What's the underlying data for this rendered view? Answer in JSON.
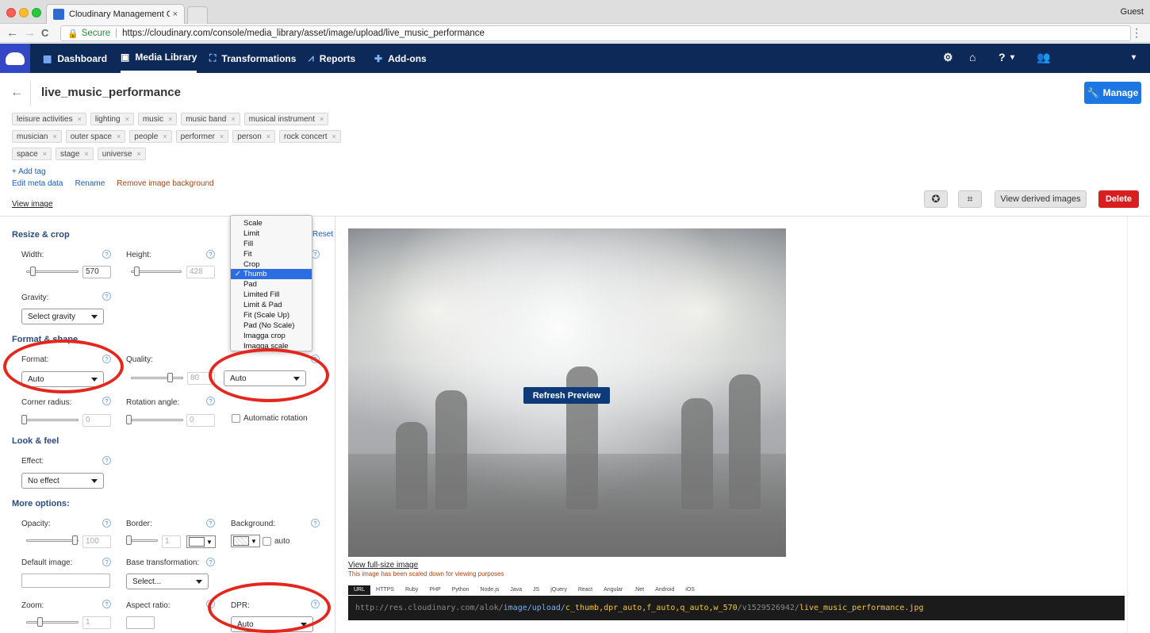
{
  "browser": {
    "tab_title": "Cloudinary Management Cons",
    "tab_close": "×",
    "guest_label": "Guest",
    "secure_label": "Secure",
    "url": "https://cloudinary.com/console/media_library/asset/image/upload/live_music_performance",
    "menu_glyph": "⋮",
    "back_glyph": "←",
    "forward_glyph": "→",
    "reload_glyph": "C"
  },
  "appnav": {
    "items": [
      {
        "label": "Dashboard",
        "icon": "dashboard-icon"
      },
      {
        "label": "Media Library",
        "icon": "media-library-icon"
      },
      {
        "label": "Transformations",
        "icon": "transformations-icon"
      },
      {
        "label": "Reports",
        "icon": "reports-icon"
      },
      {
        "label": "Add-ons",
        "icon": "add-ons-icon"
      }
    ],
    "help_caret": "▾",
    "account_caret": "▾"
  },
  "asset": {
    "title": "live_music_performance",
    "manage_label": "Manage",
    "back_glyph": "←",
    "tags_row1": [
      "leisure activities",
      "lighting",
      "music",
      "music band",
      "musical instrument"
    ],
    "tags_row2": [
      "musician",
      "outer space",
      "people",
      "performer",
      "person",
      "rock concert"
    ],
    "tags_row3": [
      "space",
      "stage",
      "universe"
    ],
    "tag_remove": "×",
    "add_tag": "+ Add tag",
    "edit_meta": "Edit meta data",
    "rename": "Rename",
    "remove_bg": "Remove image background",
    "view_image": "View image",
    "view_derived": "View derived images",
    "delete": "Delete"
  },
  "panel": {
    "resize_crop": "Resize & crop",
    "reset": "Reset",
    "help_glyph": "?",
    "width_label": "Width:",
    "width_value": "570",
    "width_slider_fraction": 0.08,
    "height_label": "Height:",
    "height_value": "428",
    "height_slider_fraction": 0.08,
    "gravity_label": "Gravity:",
    "gravity_value": "Select gravity",
    "format_shape": "Format & shape",
    "format_label": "Format:",
    "format_value": "Auto",
    "quality_label": "Quality:",
    "quality_value": "80",
    "quality_slider_fraction": 0.8,
    "crop_select_value": "Auto",
    "corner_label": "Corner radius:",
    "corner_value": "0",
    "rotation_label": "Rotation angle:",
    "rotation_value": "0",
    "auto_rotation": "Automatic rotation",
    "look_feel": "Look & feel",
    "effect_label": "Effect:",
    "effect_value": "No effect",
    "more_options": "More options:",
    "opacity_label": "Opacity:",
    "opacity_value": "100",
    "opacity_slider_fraction": 1.0,
    "border_label": "Border:",
    "border_value": "1",
    "background_label": "Background:",
    "background_auto": "auto",
    "color_dropdown_glyph": "▼",
    "default_image_label": "Default image:",
    "base_transformation_label": "Base transformation:",
    "base_transformation_value": "Select...",
    "zoom_label": "Zoom:",
    "zoom_value": "1",
    "aspect_label": "Aspect ratio:",
    "dpr_label": "DPR:",
    "dpr_value": "Auto"
  },
  "crop_dropdown": {
    "options": [
      "Scale",
      "Limit",
      "Fill",
      "Fit",
      "Crop",
      "Thumb",
      "Pad",
      "Limited Fill",
      "Limit & Pad",
      "Fit (Scale Up)",
      "Pad (No Scale)",
      "Imagga crop",
      "Imagga scale"
    ],
    "selected": "Thumb",
    "check_glyph": "✓"
  },
  "preview": {
    "refresh": "Refresh Preview",
    "full_size": "View full-size image",
    "scaled_note": "This image has been scaled down for viewing purposes",
    "code_tabs": [
      "URL",
      "HTTPS",
      "Ruby",
      "PHP",
      "Python",
      "Node.js",
      "Java",
      "JS",
      "jQuery",
      "React",
      "Angular",
      ".Net",
      "Android",
      "iOS"
    ],
    "active_tab": "URL",
    "url_base": "http://res.cloudinary.com/alok/",
    "url_path": "image/upload/",
    "url_transform": "c_thumb,dpr_auto,f_auto,q_auto,w_570",
    "url_version": "/v1529526942/",
    "url_file": "live_music_performance.jpg"
  },
  "colors": {
    "nav_bg": "#0c2957",
    "manage_blue": "#1c77e3",
    "delete_red": "#d81e1e",
    "annotation_red": "#e3271c",
    "refresh_bg": "#0d3a78"
  }
}
